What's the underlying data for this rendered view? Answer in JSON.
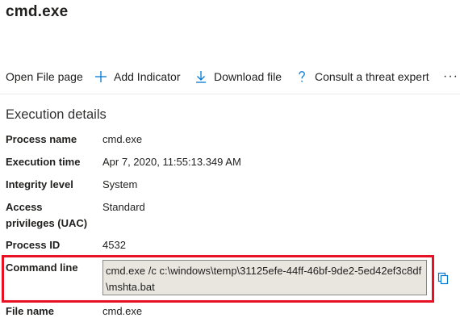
{
  "header": {
    "title": "cmd.exe"
  },
  "toolbar": {
    "open_file_page": "Open File page",
    "add_indicator": "Add Indicator",
    "download_file": "Download file",
    "consult_expert": "Consult a threat expert",
    "more": "···"
  },
  "section": {
    "title": "Execution details"
  },
  "details": {
    "process_name_label": "Process name",
    "process_name_value": "cmd.exe",
    "execution_time_label": "Execution time",
    "execution_time_value": "Apr 7, 2020, 11:55:13.349 AM",
    "integrity_level_label": "Integrity level",
    "integrity_level_value": "System",
    "access_privileges_label_line1": "Access",
    "access_privileges_label_line2": "privileges (UAC)",
    "access_privileges_value": "Standard",
    "process_id_label": "Process ID",
    "process_id_value": "4532",
    "command_line_label": "Command line",
    "command_line_value": "cmd.exe /c c:\\windows\\temp\\31125efe-44ff-46bf-9de2-5ed42ef3c8df\\mshta.bat",
    "file_name_label": "File name",
    "file_name_value": "cmd.exe"
  },
  "colors": {
    "accent": "#0078d4",
    "highlight": "#e81123",
    "command_bg": "#e8e6df"
  }
}
